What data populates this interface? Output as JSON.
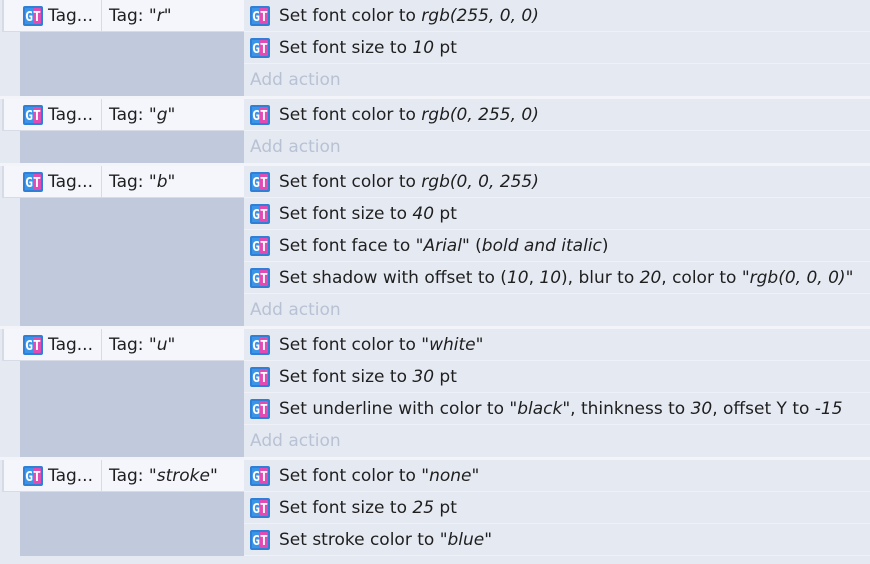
{
  "events": [
    {
      "condition": {
        "object": "Tag...",
        "text_prefix": "Tag: \"",
        "tag": "r",
        "text_suffix": "\""
      },
      "actions": [
        {
          "parts": [
            {
              "t": "Set font color to "
            },
            {
              "t": "rgb(255, 0, 0)",
              "i": true
            }
          ]
        },
        {
          "parts": [
            {
              "t": "Set font size to "
            },
            {
              "t": "10",
              "i": true
            },
            {
              "t": " pt"
            }
          ]
        }
      ],
      "add_action": "Add action"
    },
    {
      "condition": {
        "object": "Tag...",
        "text_prefix": "Tag: \"",
        "tag": "g",
        "text_suffix": "\""
      },
      "actions": [
        {
          "parts": [
            {
              "t": "Set font color to "
            },
            {
              "t": "rgb(0, 255, 0)",
              "i": true
            }
          ]
        }
      ],
      "add_action": "Add action"
    },
    {
      "condition": {
        "object": "Tag...",
        "text_prefix": "Tag: \"",
        "tag": "b",
        "text_suffix": "\""
      },
      "actions": [
        {
          "parts": [
            {
              "t": "Set font color to "
            },
            {
              "t": "rgb(0, 0, 255)",
              "i": true
            }
          ]
        },
        {
          "parts": [
            {
              "t": "Set font size to "
            },
            {
              "t": "40",
              "i": true
            },
            {
              "t": " pt"
            }
          ]
        },
        {
          "parts": [
            {
              "t": "Set font face to \""
            },
            {
              "t": "Arial",
              "i": true
            },
            {
              "t": "\" ("
            },
            {
              "t": "bold and italic",
              "i": true
            },
            {
              "t": ")"
            }
          ]
        },
        {
          "parts": [
            {
              "t": "Set shadow with offset to ("
            },
            {
              "t": "10",
              "i": true
            },
            {
              "t": ", "
            },
            {
              "t": "10",
              "i": true
            },
            {
              "t": "), blur to "
            },
            {
              "t": "20",
              "i": true
            },
            {
              "t": ", color to \""
            },
            {
              "t": "rgb(0, 0, 0)",
              "i": true
            },
            {
              "t": "\""
            }
          ]
        }
      ],
      "add_action": "Add action"
    },
    {
      "condition": {
        "object": "Tag...",
        "text_prefix": "Tag: \"",
        "tag": "u",
        "text_suffix": "\""
      },
      "actions": [
        {
          "parts": [
            {
              "t": "Set font color to \""
            },
            {
              "t": "white",
              "i": true
            },
            {
              "t": "\""
            }
          ]
        },
        {
          "parts": [
            {
              "t": "Set font size to "
            },
            {
              "t": "30",
              "i": true
            },
            {
              "t": " pt"
            }
          ]
        },
        {
          "parts": [
            {
              "t": "Set underline with color to \""
            },
            {
              "t": "black",
              "i": true
            },
            {
              "t": "\", thinkness to "
            },
            {
              "t": "30",
              "i": true
            },
            {
              "t": ", offset Y to "
            },
            {
              "t": "-15",
              "i": true
            }
          ]
        }
      ],
      "add_action": "Add action"
    },
    {
      "condition": {
        "object": "Tag...",
        "text_prefix": "Tag: \"",
        "tag": "stroke",
        "text_suffix": "\""
      },
      "actions": [
        {
          "parts": [
            {
              "t": "Set font color to \""
            },
            {
              "t": "none",
              "i": true
            },
            {
              "t": "\""
            }
          ]
        },
        {
          "parts": [
            {
              "t": "Set font size to "
            },
            {
              "t": "25",
              "i": true
            },
            {
              "t": " pt"
            }
          ]
        },
        {
          "parts": [
            {
              "t": "Set stroke color to \""
            },
            {
              "t": "blue",
              "i": true
            },
            {
              "t": "\""
            }
          ]
        }
      ],
      "add_action": ""
    }
  ],
  "icon": {
    "name": "text-object-icon",
    "colors": {
      "frame": "#2f7fd6",
      "fill": "#e24bb3",
      "glyph": "#ffffff"
    }
  }
}
